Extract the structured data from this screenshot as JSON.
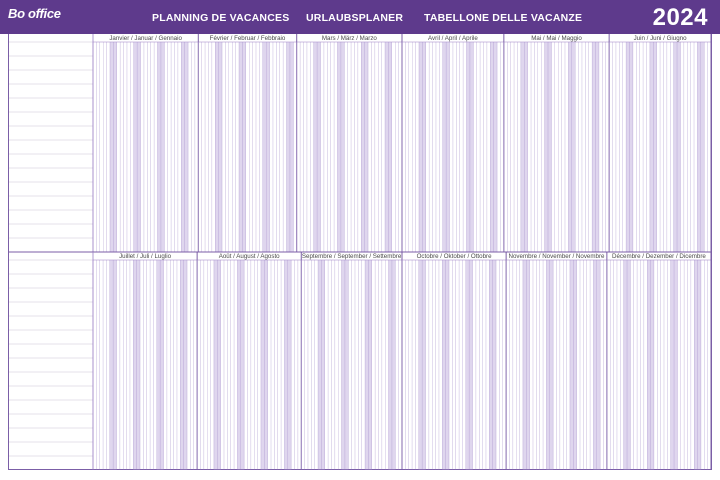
{
  "header": {
    "brand": "Bo office",
    "titles": [
      "PLANNING DE VACANCES",
      "URLAUBSPLANER",
      "TABELLONE DELLE VACANZE"
    ],
    "year": "2024",
    "colors": {
      "band": "#5e3a8c",
      "text": "#ffffff",
      "line": "#9a7fc4",
      "weekend": "#b9a3d9"
    }
  },
  "planner": {
    "halves": [
      {
        "months": [
          {
            "label": "Janvier / Januar / Gennaio",
            "days": 31
          },
          {
            "label": "Février / Februar / Febbraio",
            "days": 29
          },
          {
            "label": "Mars / März / Marzo",
            "days": 31
          },
          {
            "label": "Avril / April / Aprile",
            "days": 30
          },
          {
            "label": "Mai / Mai / Maggio",
            "days": 31
          },
          {
            "label": "Juin / Juni / Giugno",
            "days": 30
          }
        ]
      },
      {
        "months": [
          {
            "label": "Juillet / Juli / Luglio",
            "days": 31
          },
          {
            "label": "Août / August / Agosto",
            "days": 31
          },
          {
            "label": "Septembre / September / Settembre",
            "days": 30
          },
          {
            "label": "Octobre / Oktober / Ottobre",
            "days": 31
          },
          {
            "label": "Novembre / November / Novembre",
            "days": 30
          },
          {
            "label": "Décembre / Dezember / Dicembre",
            "days": 31
          }
        ]
      }
    ],
    "name_rows_per_half": 15
  }
}
